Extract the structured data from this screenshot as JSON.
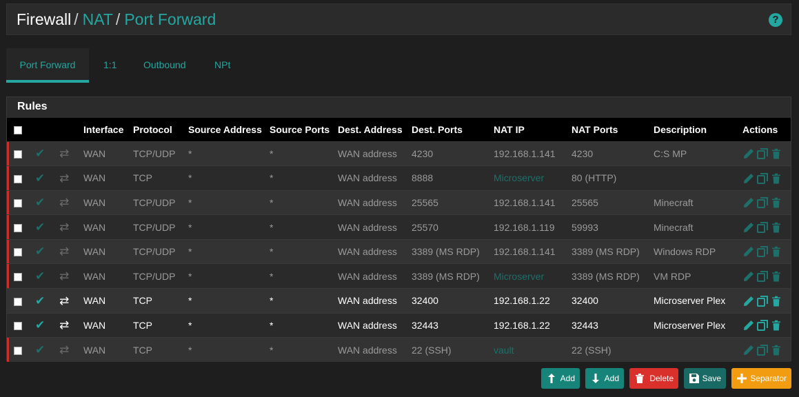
{
  "breadcrumb": {
    "root": "Firewall",
    "items": [
      "NAT",
      "Port Forward"
    ],
    "separator": "/"
  },
  "help_label": "?",
  "tabs": [
    {
      "label": "Port Forward",
      "active": true
    },
    {
      "label": "1:1",
      "active": false
    },
    {
      "label": "Outbound",
      "active": false
    },
    {
      "label": "NPt",
      "active": false
    }
  ],
  "rules": {
    "title": "Rules",
    "columns": [
      "",
      "",
      "",
      "Interface",
      "Protocol",
      "Source Address",
      "Source Ports",
      "Dest. Address",
      "Dest. Ports",
      "NAT IP",
      "NAT Ports",
      "Description",
      "Actions"
    ],
    "rows": [
      {
        "interface": "WAN",
        "protocol": "TCP/UDP",
        "src_addr": "*",
        "src_ports": "*",
        "dest_addr": "WAN address",
        "dest_ports": "4230",
        "nat_ip": "192.168.1.141",
        "nat_ip_alias": false,
        "nat_ports": "4230",
        "description": "C:S MP",
        "enabled": false
      },
      {
        "interface": "WAN",
        "protocol": "TCP",
        "src_addr": "*",
        "src_ports": "*",
        "dest_addr": "WAN address",
        "dest_ports": "8888",
        "nat_ip": "Microserver",
        "nat_ip_alias": true,
        "nat_ports": "80 (HTTP)",
        "description": "",
        "enabled": false
      },
      {
        "interface": "WAN",
        "protocol": "TCP/UDP",
        "src_addr": "*",
        "src_ports": "*",
        "dest_addr": "WAN address",
        "dest_ports": "25565",
        "nat_ip": "192.168.1.141",
        "nat_ip_alias": false,
        "nat_ports": "25565",
        "description": "Minecraft",
        "enabled": false
      },
      {
        "interface": "WAN",
        "protocol": "TCP/UDP",
        "src_addr": "*",
        "src_ports": "*",
        "dest_addr": "WAN address",
        "dest_ports": "25570",
        "nat_ip": "192.168.1.119",
        "nat_ip_alias": false,
        "nat_ports": "59993",
        "description": "Minecraft",
        "enabled": false
      },
      {
        "interface": "WAN",
        "protocol": "TCP/UDP",
        "src_addr": "*",
        "src_ports": "*",
        "dest_addr": "WAN address",
        "dest_ports": "3389 (MS RDP)",
        "nat_ip": "192.168.1.141",
        "nat_ip_alias": false,
        "nat_ports": "3389 (MS RDP)",
        "description": "Windows RDP",
        "enabled": false
      },
      {
        "interface": "WAN",
        "protocol": "TCP/UDP",
        "src_addr": "*",
        "src_ports": "*",
        "dest_addr": "WAN address",
        "dest_ports": "3389 (MS RDP)",
        "nat_ip": "Microserver",
        "nat_ip_alias": true,
        "nat_ports": "3389 (MS RDP)",
        "description": "VM RDP",
        "enabled": false
      },
      {
        "interface": "WAN",
        "protocol": "TCP",
        "src_addr": "*",
        "src_ports": "*",
        "dest_addr": "WAN address",
        "dest_ports": "32400",
        "nat_ip": "192.168.1.22",
        "nat_ip_alias": false,
        "nat_ports": "32400",
        "description": "Microserver Plex",
        "enabled": true
      },
      {
        "interface": "WAN",
        "protocol": "TCP",
        "src_addr": "*",
        "src_ports": "*",
        "dest_addr": "WAN address",
        "dest_ports": "32443",
        "nat_ip": "192.168.1.22",
        "nat_ip_alias": false,
        "nat_ports": "32443",
        "description": "Microserver Plex",
        "enabled": true
      },
      {
        "interface": "WAN",
        "protocol": "TCP",
        "src_addr": "*",
        "src_ports": "*",
        "dest_addr": "WAN address",
        "dest_ports": "22 (SSH)",
        "nat_ip": "vault",
        "nat_ip_alias": true,
        "nat_ports": "22 (SSH)",
        "description": "",
        "enabled": false
      }
    ]
  },
  "buttons": {
    "add_top": "Add",
    "add_bottom": "Add",
    "delete": "Delete",
    "save": "Save",
    "separator": "Separator"
  },
  "colors": {
    "accent": "#23a7a0",
    "disabled_marker": "#c9302c",
    "delete": "#d9302c",
    "separator": "#f29c11"
  },
  "icons": {
    "check": "check-icon",
    "shuffle": "shuffle-icon",
    "edit": "pencil-icon",
    "copy": "copy-icon",
    "delete": "trash-icon",
    "help": "help-icon"
  }
}
